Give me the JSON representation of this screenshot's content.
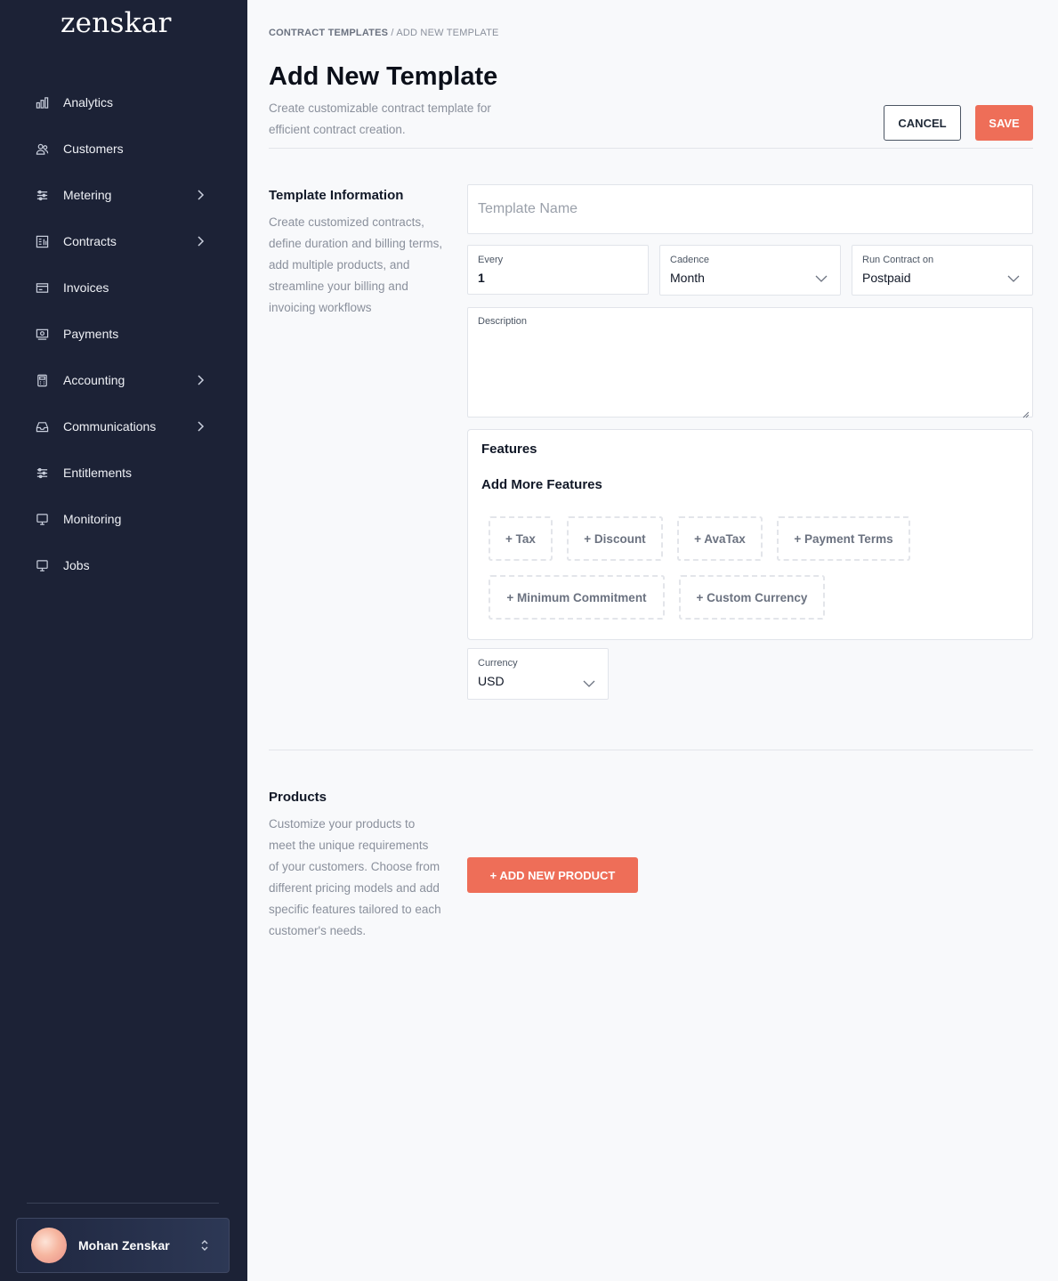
{
  "app": {
    "logo": "zenskar"
  },
  "sidebar": {
    "items": [
      {
        "label": "Analytics",
        "icon": "bar-chart-icon",
        "has_submenu": false
      },
      {
        "label": "Customers",
        "icon": "users-icon",
        "has_submenu": false
      },
      {
        "label": "Metering",
        "icon": "sliders-icon",
        "has_submenu": true
      },
      {
        "label": "Contracts",
        "icon": "contract-icon",
        "has_submenu": true
      },
      {
        "label": "Invoices",
        "icon": "invoice-icon",
        "has_submenu": false
      },
      {
        "label": "Payments",
        "icon": "payments-icon",
        "has_submenu": false
      },
      {
        "label": "Accounting",
        "icon": "calculator-icon",
        "has_submenu": true
      },
      {
        "label": "Communications",
        "icon": "inbox-icon",
        "has_submenu": true
      },
      {
        "label": "Entitlements",
        "icon": "sliders-icon",
        "has_submenu": false
      },
      {
        "label": "Monitoring",
        "icon": "monitor-icon",
        "has_submenu": false
      },
      {
        "label": "Jobs",
        "icon": "monitor-icon",
        "has_submenu": false
      }
    ],
    "user": {
      "name": "Mohan Zenskar"
    }
  },
  "breadcrumb": {
    "parent": "CONTRACT TEMPLATES",
    "separator": " / ",
    "current": "ADD NEW TEMPLATE"
  },
  "header": {
    "title": "Add New Template",
    "subtitle": "Create customizable contract template for efficient contract creation.",
    "cancel_label": "CANCEL",
    "save_label": "SAVE"
  },
  "template_info": {
    "title": "Template Information",
    "description": "Create customized contracts, define duration and billing terms, add multiple products, and streamline your billing and invoicing workflows",
    "name_placeholder": "Template Name",
    "every": {
      "label": "Every",
      "value": "1"
    },
    "cadence": {
      "label": "Cadence",
      "value": "Month"
    },
    "run_contract_on": {
      "label": "Run Contract on",
      "value": "Postpaid"
    },
    "description_field": {
      "label": "Description",
      "value": ""
    }
  },
  "features": {
    "title": "Features",
    "add_more_title": "Add More Features",
    "chips": [
      "+ Tax",
      "+ Discount",
      "+ AvaTax",
      "+ Payment Terms",
      "+ Minimum Commitment",
      "+ Custom Currency"
    ]
  },
  "currency": {
    "label": "Currency",
    "value": "USD"
  },
  "products": {
    "title": "Products",
    "description": "Customize your products to meet the unique requirements of your customers. Choose from different pricing models and add specific features tailored to each customer's needs.",
    "add_button_label": "+ ADD NEW PRODUCT"
  },
  "colors": {
    "sidebar_bg": "#1c2236",
    "accent": "#ee6e58",
    "page_bg": "#f8f9fb"
  }
}
